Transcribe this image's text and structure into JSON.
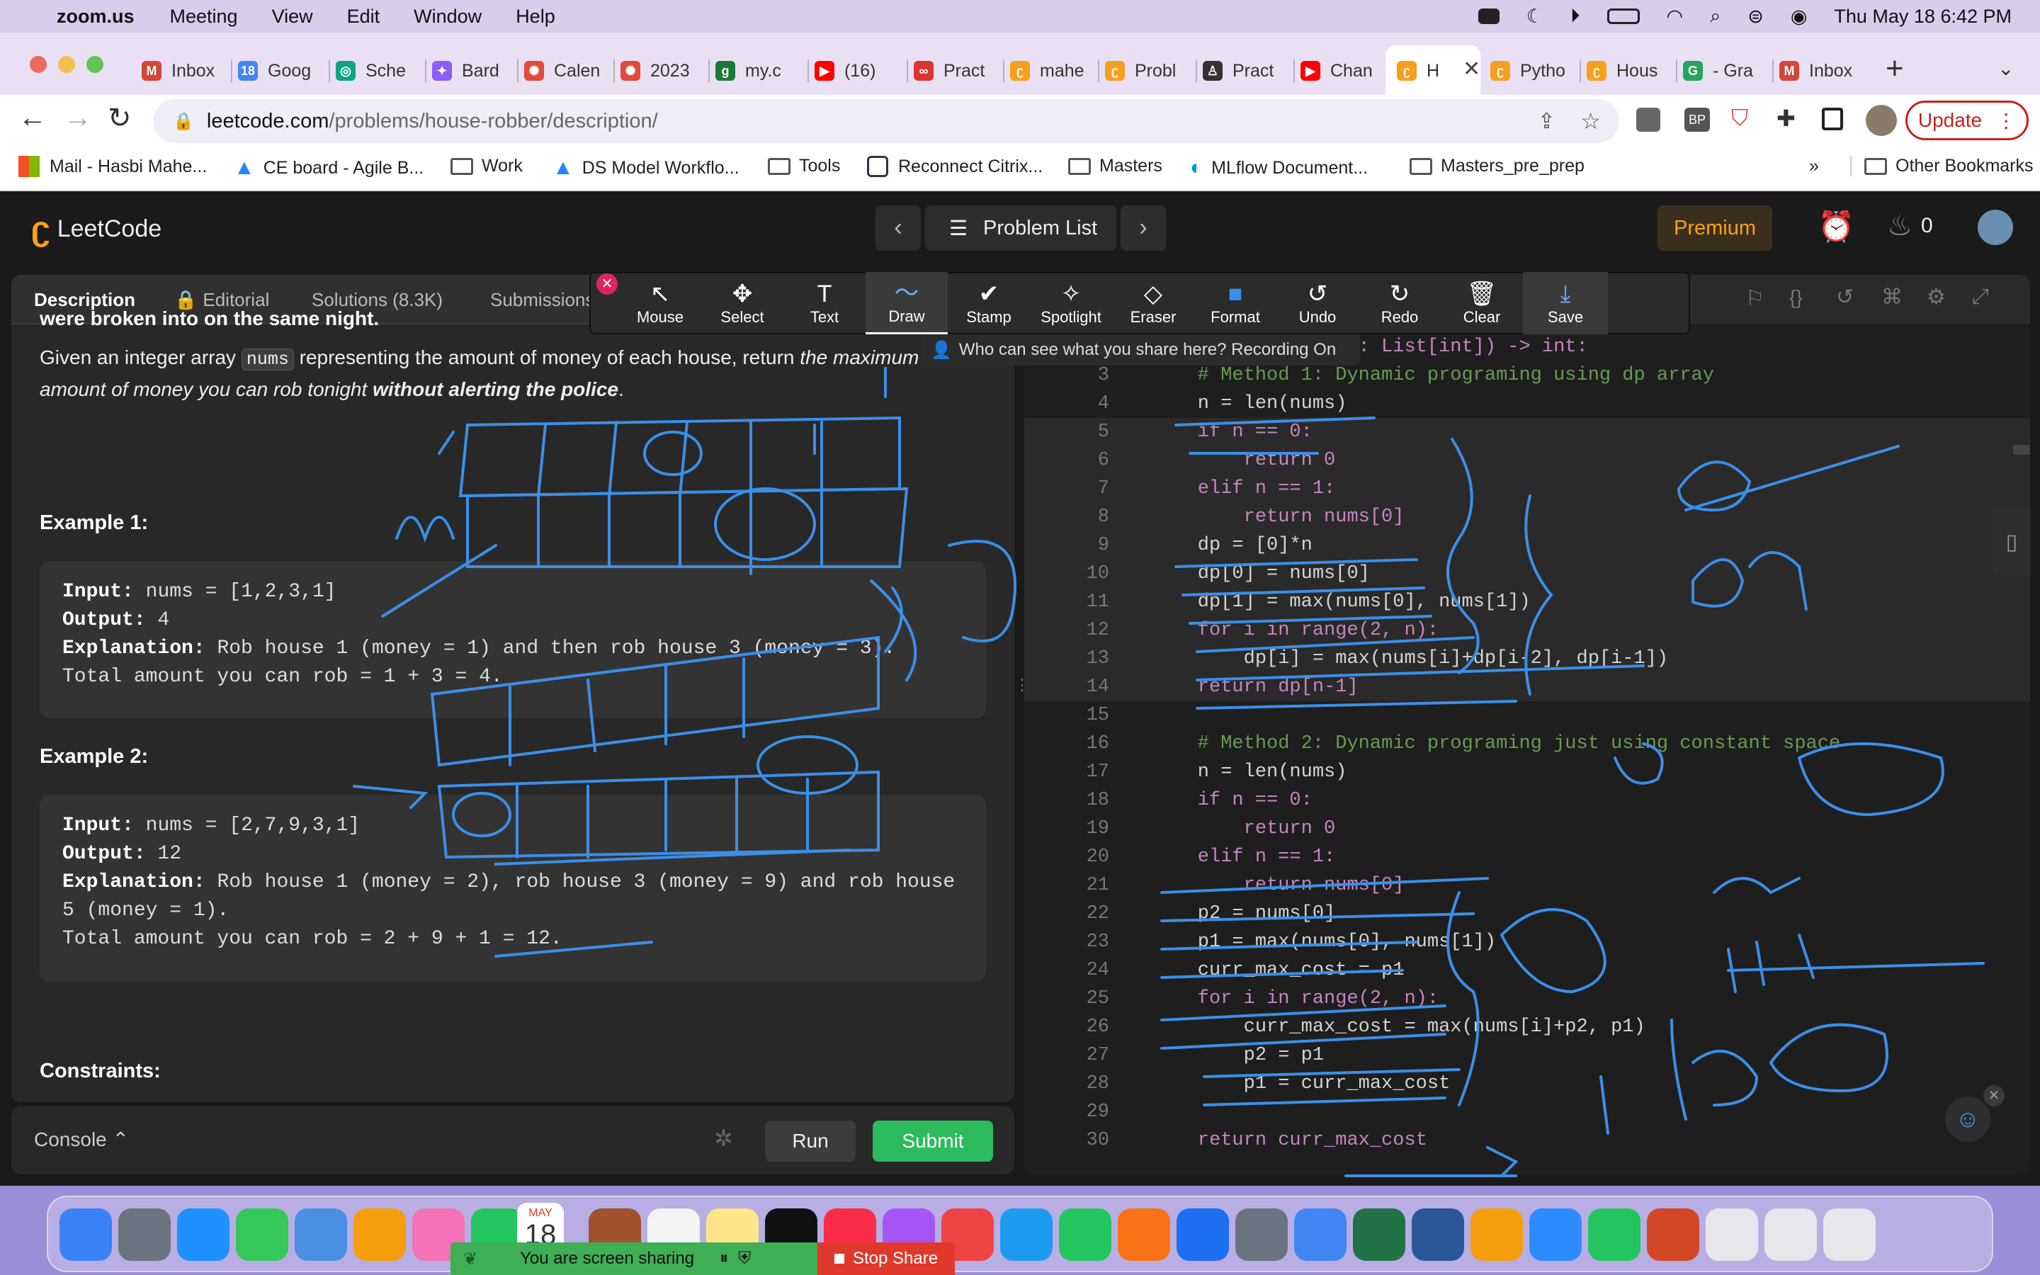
{
  "menubar": {
    "app": "zoom.us",
    "items": [
      "Meeting",
      "View",
      "Edit",
      "Window",
      "Help"
    ],
    "clock": "Thu May 18  6:42 PM"
  },
  "tabs": [
    {
      "label": "Inbox",
      "color": "#d44638",
      "glyph": "M"
    },
    {
      "label": "Goog",
      "color": "#4285f4",
      "glyph": "18"
    },
    {
      "label": "Sche",
      "color": "#10a37f",
      "glyph": "◎"
    },
    {
      "label": "Bard",
      "color": "#8b5cf6",
      "glyph": "✦"
    },
    {
      "label": "Calen",
      "color": "#e04b3a",
      "glyph": "✺"
    },
    {
      "label": "2023",
      "color": "#e04b3a",
      "glyph": "✺"
    },
    {
      "label": "my.c",
      "color": "#1a7a3a",
      "glyph": "g"
    },
    {
      "label": "(16)",
      "color": "#ff0000",
      "glyph": "▶"
    },
    {
      "label": "Pract",
      "color": "#d33",
      "glyph": "∞"
    },
    {
      "label": "mahe",
      "color": "#f89f1b",
      "glyph": "ʗ"
    },
    {
      "label": "Probl",
      "color": "#f89f1b",
      "glyph": "ʗ"
    },
    {
      "label": "Pract",
      "color": "#333",
      "glyph": "♙"
    },
    {
      "label": "Chan",
      "color": "#ff0000",
      "glyph": "▶"
    },
    {
      "label": "H",
      "color": "#f89f1b",
      "glyph": "ʗ"
    },
    {
      "label": "Pytho",
      "color": "#f89f1b",
      "glyph": "ʗ"
    },
    {
      "label": "Hous",
      "color": "#f89f1b",
      "glyph": "ʗ"
    },
    {
      "label": "- Gra",
      "color": "#25a55f",
      "glyph": "G"
    },
    {
      "label": "Inbox",
      "color": "#d44638",
      "glyph": "M"
    }
  ],
  "url": {
    "host": "leetcode.com",
    "path": "/problems/house-robber/description/"
  },
  "update_label": "Update",
  "bookmarks": [
    "Mail - Hasbi Mahe...",
    "CE board - Agile B...",
    "Work",
    "DS Model Workflo...",
    "Tools",
    "Reconnect Citrix...",
    "Masters",
    "MLflow Document...",
    "Masters_pre_prep"
  ],
  "bookmarks_more": "»",
  "other_bookmarks": "Other Bookmarks",
  "lc": {
    "logo": "LeetCode",
    "problem_list": "Problem List",
    "premium": "Premium",
    "streak": "0"
  },
  "left_tabs": [
    "Description",
    "Editorial",
    "Solutions (8.3K)",
    "Submissions"
  ],
  "desc": {
    "cut_line": "were broken into on the same night.",
    "p1": "Given an integer array",
    "code_nums": "nums",
    "p2": "representing the amount of money of each house, return",
    "p3": "the maximum",
    "p4": "amount of money you can rob tonight",
    "p5": "without alerting the police",
    "p6": "."
  },
  "ex1": {
    "title": "Example 1:",
    "input_k": "Input:",
    "input_v": "nums = [1,2,3,1]",
    "output_k": "Output:",
    "output_v": "4",
    "expl_k": "Explanation:",
    "expl_v": "Rob house 1 (money = 1) and then rob house 3 (money = 3).",
    "total": "Total amount you can rob = 1 + 3 = 4."
  },
  "ex2": {
    "title": "Example 2:",
    "input_k": "Input:",
    "input_v": "nums = [2,7,9,3,1]",
    "output_k": "Output:",
    "output_v": "12",
    "expl_k": "Explanation:",
    "expl_v": "Rob house 1 (money = 2), rob house 3 (money = 9) and rob house",
    "expl_v2": "5 (money = 1).",
    "total": "Total amount you can rob = 2 + 9 + 1 = 12."
  },
  "constraints": "Constraints:",
  "console": {
    "label": "Console",
    "run": "Run",
    "submit": "Submit"
  },
  "zoom_tools": [
    {
      "glyph": "↖",
      "label": "Mouse"
    },
    {
      "glyph": "✥",
      "label": "Select"
    },
    {
      "glyph": "T",
      "label": "Text"
    },
    {
      "glyph": "〜",
      "label": "Draw"
    },
    {
      "glyph": "✔",
      "label": "Stamp"
    },
    {
      "glyph": "✧",
      "label": "Spotlight"
    },
    {
      "glyph": "◇",
      "label": "Eraser"
    },
    {
      "glyph": "■",
      "label": "Format"
    },
    {
      "glyph": "↺",
      "label": "Undo"
    },
    {
      "glyph": "↻",
      "label": "Redo"
    },
    {
      "glyph": "🗑",
      "label": "Clear"
    },
    {
      "glyph": "⤓",
      "label": "Save"
    }
  ],
  "zoom_notice": "Who can see what you share here? Recording On",
  "code": [
    {
      "n": "2",
      "t": "def rob(self, nums: List[int]) -> int:"
    },
    {
      "n": "3",
      "t": "    # Method 1: Dynamic programing using dp array"
    },
    {
      "n": "4",
      "t": "    n = len(nums)"
    },
    {
      "n": "5",
      "t": "    if n == 0:"
    },
    {
      "n": "6",
      "t": "        return 0"
    },
    {
      "n": "7",
      "t": "    elif n == 1:"
    },
    {
      "n": "8",
      "t": "        return nums[0]"
    },
    {
      "n": "9",
      "t": "    dp = [0]*n"
    },
    {
      "n": "10",
      "t": "    dp[0] = nums[0]"
    },
    {
      "n": "11",
      "t": "    dp[1] = max(nums[0], nums[1])"
    },
    {
      "n": "12",
      "t": "    for i in range(2, n):"
    },
    {
      "n": "13",
      "t": "        dp[i] = max(nums[i]+dp[i-2], dp[i-1])"
    },
    {
      "n": "14",
      "t": "    return dp[n-1]"
    },
    {
      "n": "15",
      "t": ""
    },
    {
      "n": "16",
      "t": "    # Method 2: Dynamic programing just using constant space"
    },
    {
      "n": "17",
      "t": "    n = len(nums)"
    },
    {
      "n": "18",
      "t": "    if n == 0:"
    },
    {
      "n": "19",
      "t": "        return 0"
    },
    {
      "n": "20",
      "t": "    elif n == 1:"
    },
    {
      "n": "21",
      "t": "        return nums[0]"
    },
    {
      "n": "22",
      "t": "    p2 = nums[0]"
    },
    {
      "n": "23",
      "t": "    p1 = max(nums[0], nums[1])"
    },
    {
      "n": "24",
      "t": "    curr_max_cost = p1"
    },
    {
      "n": "25",
      "t": "    for i in range(2, n):"
    },
    {
      "n": "26",
      "t": "        curr_max_cost = max(nums[i]+p2, p1)"
    },
    {
      "n": "27",
      "t": "        p2 = p1"
    },
    {
      "n": "28",
      "t": "        p1 = curr_max_cost"
    },
    {
      "n": "29",
      "t": ""
    },
    {
      "n": "30",
      "t": "    return curr_max_cost"
    }
  ],
  "share": {
    "sharing": "You are screen sharing",
    "stop": "Stop Share"
  },
  "dock_calendar": {
    "month": "MAY",
    "day": "18"
  },
  "colors": {
    "lc_orange": "#ffa116",
    "submit_green": "#2cbb5d",
    "ink": "#3b8fe8",
    "premium_bg": "#3a2f1c"
  }
}
